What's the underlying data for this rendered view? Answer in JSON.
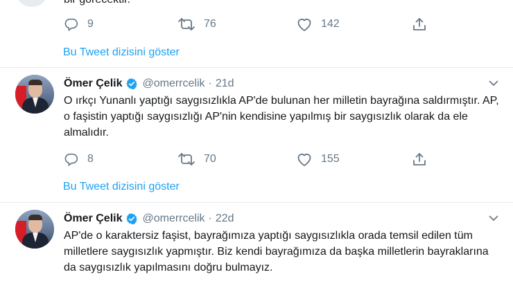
{
  "top_tweet": {
    "cut_text": "bir görecektir.",
    "reply_count": "9",
    "retweet_count": "76",
    "like_count": "142",
    "show_thread_label": "Bu Tweet dizisini göster"
  },
  "tweets": [
    {
      "author_name": "Ömer Çelik",
      "handle": "@omerrcelik",
      "separator": "·",
      "time": "21d",
      "text": "O ırkçı Yunanlı yaptığı saygısızlıkla AP'de bulunan her milletin bayrağına saldırmıştır. AP, o faşistin yaptığı saygısızlığı AP'nin kendisine yapılmış bir saygısızlık olarak da ele almalıdır.",
      "reply_count": "8",
      "retweet_count": "70",
      "like_count": "155",
      "show_thread_label": "Bu Tweet dizisini göster"
    },
    {
      "author_name": "Ömer Çelik",
      "handle": "@omerrcelik",
      "separator": "·",
      "time": "22d",
      "text": "AP'de o karaktersiz faşist, bayrağımıza yaptığı saygısızlıkla orada temsil edilen tüm milletlere saygısızlık yapmıştır. Biz kendi bayrağımıza da başka milletlerin bayraklarına da saygısızlık yapılmasını doğru bulmayız."
    }
  ],
  "colors": {
    "text": "#14171a",
    "secondary": "#657786",
    "link": "#1da1f2",
    "divider": "#e6ecf0",
    "verified": "#1da1f2"
  },
  "icons": {
    "reply": "reply-icon",
    "retweet": "retweet-icon",
    "like": "heart-icon",
    "share": "share-icon",
    "verified": "verified-badge-icon",
    "caret": "chevron-down-icon"
  }
}
